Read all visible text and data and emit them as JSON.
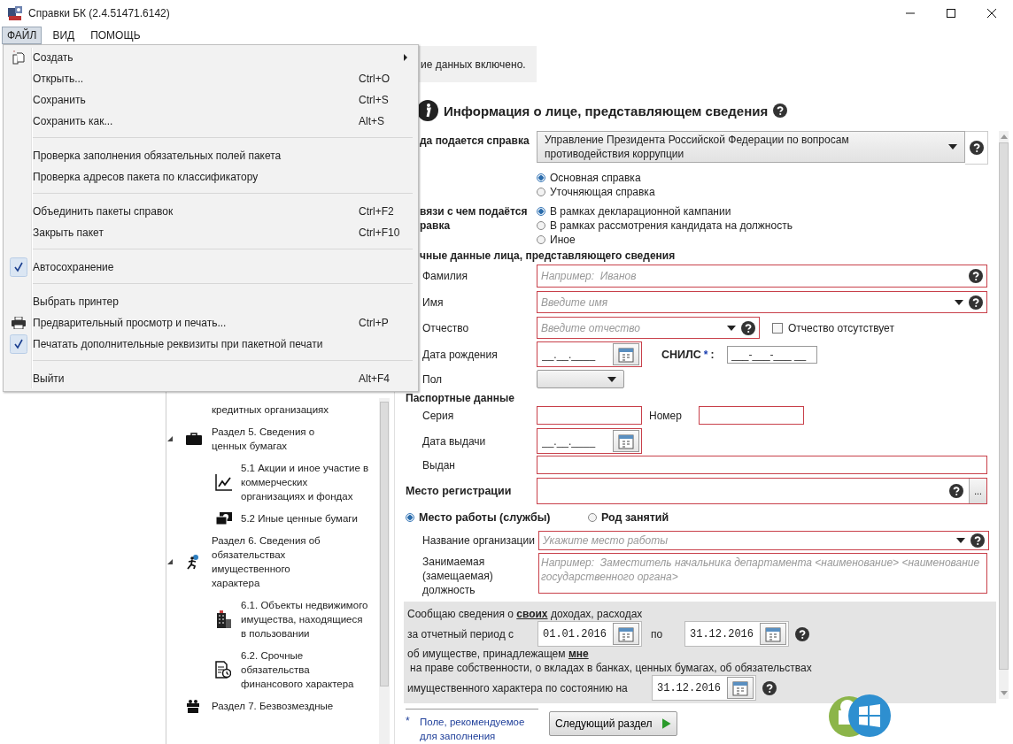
{
  "window": {
    "title": "Справки БК (2.4.51471.6142)"
  },
  "menubar": [
    {
      "label": "ФАЙЛ",
      "selected": true
    },
    {
      "label": "ВИД",
      "selected": false
    },
    {
      "label": "ПОМОЩЬ",
      "selected": false
    }
  ],
  "file_menu": {
    "items": [
      {
        "kind": "item",
        "label": "Создать",
        "submenu": true,
        "checked": false
      },
      {
        "kind": "item",
        "label": "Открыть...",
        "shortcut": "Ctrl+O",
        "submenu": false,
        "checked": false
      },
      {
        "kind": "item",
        "label": "Сохранить",
        "shortcut": "Ctrl+S",
        "submenu": false,
        "checked": false
      },
      {
        "kind": "item",
        "label": "Сохранить как...",
        "shortcut": "Alt+S",
        "submenu": false,
        "checked": false
      },
      {
        "kind": "separator"
      },
      {
        "kind": "item",
        "label": "Проверка заполнения обязательных полей пакета",
        "submenu": false,
        "checked": false
      },
      {
        "kind": "item",
        "label": "Проверка адресов пакета по классификатору",
        "submenu": false,
        "checked": false
      },
      {
        "kind": "separator"
      },
      {
        "kind": "item",
        "label": "Объединить пакеты справок",
        "shortcut": "Ctrl+F2",
        "submenu": false,
        "checked": false
      },
      {
        "kind": "item",
        "label": "Закрыть пакет",
        "shortcut": "Ctrl+F10",
        "submenu": false,
        "checked": false
      },
      {
        "kind": "separator"
      },
      {
        "kind": "item",
        "label": "Автосохранение",
        "submenu": false,
        "checked": true
      },
      {
        "kind": "separator"
      },
      {
        "kind": "item",
        "label": "Выбрать принтер",
        "submenu": false,
        "checked": false
      },
      {
        "kind": "item",
        "label": "Предварительный просмотр и печать...",
        "shortcut": "Ctrl+P",
        "submenu": false,
        "checked": false
      },
      {
        "kind": "item",
        "label": "Печатать дополнительные реквизиты при пакетной печати",
        "submenu": false,
        "checked": true
      },
      {
        "kind": "separator"
      },
      {
        "kind": "item",
        "label": "Выйти",
        "shortcut": "Alt+F4",
        "submenu": false,
        "checked": false
      }
    ]
  },
  "tree": {
    "items": [
      {
        "label": "кредитных организациях",
        "expanded": false
      },
      {
        "label": "Раздел 5. Сведения о ценных бумагах",
        "expanded": true,
        "children": [
          {
            "label": "5.1 Акции и иное участие в коммерческих организациях и фондах"
          },
          {
            "label": "5.2 Иные ценные бумаги"
          }
        ]
      },
      {
        "label": "Раздел 6. Сведения об обязательствах имущественного характера",
        "expanded": true,
        "children": [
          {
            "label": "6.1. Объекты недвижимого имущества, находящиеся в пользовании"
          },
          {
            "label": "6.2. Срочные обязательства финансового характера"
          }
        ]
      },
      {
        "label": "Раздел 7. Безвозмездные",
        "expanded": false
      }
    ]
  },
  "info_bar": {
    "text": "ие данных включено."
  },
  "form": {
    "title": "Информация о лице, представляющем сведения",
    "recipient": {
      "label": "да подается справка",
      "value": "Управление Президента Российской Федерации по вопросам противодействия коррупции"
    },
    "report_type": [
      {
        "label": "Основная справка",
        "selected": true
      },
      {
        "label": "Уточняющая справка",
        "selected": false
      }
    ],
    "reason": {
      "label_lines": [
        "вязи с чем подаётся",
        "равка"
      ],
      "options": [
        {
          "label": "В рамках декларационной кампании",
          "selected": true
        },
        {
          "label": "В рамках рассмотрения кандидата на должность",
          "selected": false
        },
        {
          "label": "Иное",
          "selected": false
        }
      ]
    },
    "personal": {
      "title": "чные данные лица, представляющего сведения",
      "surname": {
        "label": "Фамилия",
        "placeholder": "Например:  Иванов"
      },
      "name": {
        "label": "Имя",
        "placeholder": "Введите имя"
      },
      "patronymic": {
        "label": "Отчество",
        "placeholder": "Введите отчество",
        "none_label": "Отчество отсутствует",
        "none_checked": false
      },
      "birth_date": {
        "label": "Дата рождения",
        "placeholder": "__.__.____"
      },
      "snils": {
        "label": "СНИЛС",
        "required_mark": "*",
        "label_suffix": ":",
        "placeholder": "___-___-___ __"
      },
      "gender": {
        "label": "Пол"
      }
    },
    "passport": {
      "title": "Паспортные данные",
      "series": {
        "label": "Серия"
      },
      "number": {
        "label": "Номер"
      },
      "issue_date": {
        "label": "Дата выдачи",
        "placeholder": "__.__.____"
      },
      "issued_by": {
        "label": "Выдан"
      }
    },
    "registration": {
      "label": "Место регистрации",
      "button": "..."
    },
    "work_mode": [
      {
        "label": "Место работы (службы)",
        "selected": true
      },
      {
        "label": "Род занятий",
        "selected": false
      }
    ],
    "organization": {
      "label": "Название организации",
      "placeholder": "Укажите место работы"
    },
    "position": {
      "label": "Занимаемая (замещаемая) должность",
      "placeholder": "Например:  Заместитель начальника департамента <наименование> <наименование государственного органа>"
    },
    "declaration": {
      "line1": "Сообщаю сведения о **своих** доходах, расходах",
      "period_label": "за отчетный период с",
      "date_from": "01.01.2016",
      "to_label": "по",
      "date_to": "31.12.2016",
      "line3": "об имуществе, принадлежащем **мне**",
      "line4": "на праве собственности, о вкладах в банках, ценных бумагах, об обязательствах",
      "as_of_label": "имущественного характера по состоянию на",
      "as_of_date": "31.12.2016"
    },
    "footnote": {
      "mark": "*",
      "text": "Поле, рекомендуемое для заполнения"
    },
    "next_button": "Следующий раздел"
  }
}
